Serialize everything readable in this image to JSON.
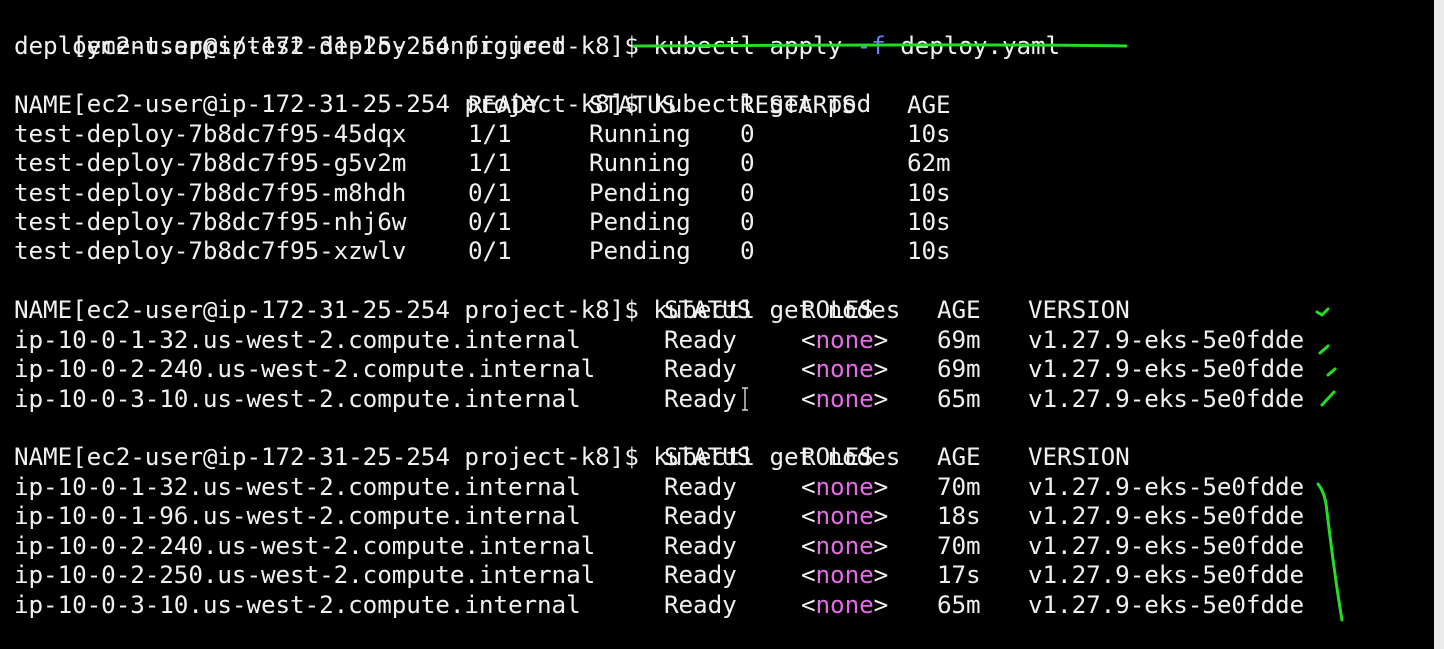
{
  "prompt": "[ec2-user@ip-172-31-25-254 project-k8]$ ",
  "apply": {
    "cmd_a": "kubectl apply ",
    "flag": "-f",
    "cmd_b": " deploy.yaml",
    "output": "deployment.apps/test-deploy configured"
  },
  "cmd_get_pod": "kubectl get pod",
  "cmd_get_nodes": "kubectl get nodes",
  "pod_headers": [
    "NAME",
    "READY",
    "STATUS",
    "RESTARTS",
    "AGE"
  ],
  "pods": [
    {
      "name": "test-deploy-7b8dc7f95-45dqx",
      "ready": "1/1",
      "status": "Running",
      "restarts": "0",
      "age": "10s"
    },
    {
      "name": "test-deploy-7b8dc7f95-g5v2m",
      "ready": "1/1",
      "status": "Running",
      "restarts": "0",
      "age": "62m"
    },
    {
      "name": "test-deploy-7b8dc7f95-m8hdh",
      "ready": "0/1",
      "status": "Pending",
      "restarts": "0",
      "age": "10s"
    },
    {
      "name": "test-deploy-7b8dc7f95-nhj6w",
      "ready": "0/1",
      "status": "Pending",
      "restarts": "0",
      "age": "10s"
    },
    {
      "name": "test-deploy-7b8dc7f95-xzwlv",
      "ready": "0/1",
      "status": "Pending",
      "restarts": "0",
      "age": "10s"
    }
  ],
  "node_headers": [
    "NAME",
    "STATUS",
    "ROLES",
    "AGE",
    "VERSION"
  ],
  "roles": {
    "open": "<",
    "value": "none",
    "close": ">"
  },
  "nodes1": [
    {
      "name": "ip-10-0-1-32.us-west-2.compute.internal",
      "status": "Ready",
      "age": "69m",
      "version": "v1.27.9-eks-5e0fdde"
    },
    {
      "name": "ip-10-0-2-240.us-west-2.compute.internal",
      "status": "Ready",
      "age": "69m",
      "version": "v1.27.9-eks-5e0fdde"
    },
    {
      "name": "ip-10-0-3-10.us-west-2.compute.internal",
      "status": "Ready",
      "age": "65m",
      "version": "v1.27.9-eks-5e0fdde"
    }
  ],
  "nodes2": [
    {
      "name": "ip-10-0-1-32.us-west-2.compute.internal",
      "status": "Ready",
      "age": "70m",
      "version": "v1.27.9-eks-5e0fdde"
    },
    {
      "name": "ip-10-0-1-96.us-west-2.compute.internal",
      "status": "Ready",
      "age": "18s",
      "version": "v1.27.9-eks-5e0fdde"
    },
    {
      "name": "ip-10-0-2-240.us-west-2.compute.internal",
      "status": "Ready",
      "age": "70m",
      "version": "v1.27.9-eks-5e0fdde"
    },
    {
      "name": "ip-10-0-2-250.us-west-2.compute.internal",
      "status": "Ready",
      "age": "17s",
      "version": "v1.27.9-eks-5e0fdde"
    },
    {
      "name": "ip-10-0-3-10.us-west-2.compute.internal",
      "status": "Ready",
      "age": "65m",
      "version": "v1.27.9-eks-5e0fdde"
    }
  ],
  "colors": {
    "background": "#000000",
    "text": "#f0f0f0",
    "flag": "#6f7dff",
    "none_keyword": "#e66ae6",
    "annotation": "#22dd22",
    "cursor": "#c8c8c8"
  }
}
